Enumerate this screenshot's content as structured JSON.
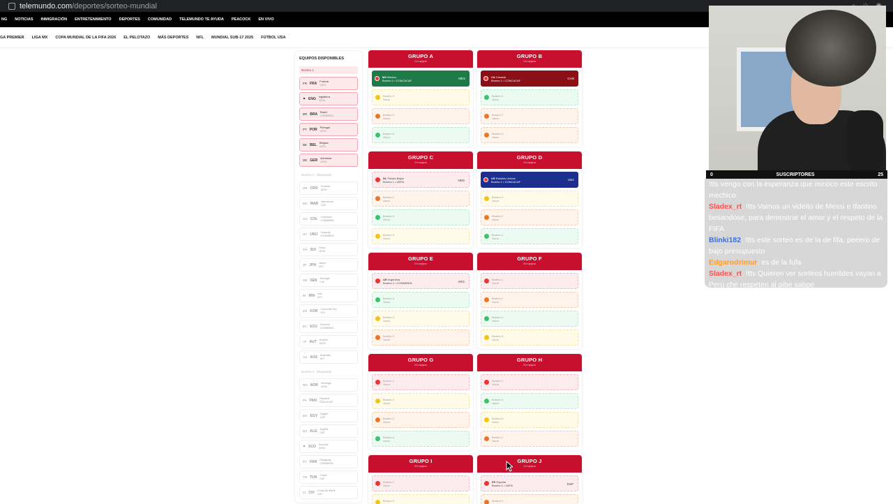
{
  "browser": {
    "host": "telemundo.com",
    "path": "/deportes/sorteo-mundial"
  },
  "nav_primary": [
    "NG",
    "NOTICIAS",
    "INMIGRACIÓN",
    "ENTRETENIMIENTO",
    "DEPORTES",
    "COMUNIDAD",
    "TELEMUNDO TE AYUDA",
    "PEACOCK",
    "EN VIVO"
  ],
  "nav_secondary": [
    "GA PREMIER",
    "LIGA MX",
    "COPA MUNDIAL DE LA FIFA 2026",
    "EL PELOTAZO",
    "MÁS DEPORTES",
    "NFL",
    "MUNDIAL SUB-17 2025",
    "FÚTBOL USA"
  ],
  "available": {
    "title": "EQUIPOS DISPONIBLES",
    "bombo1_title": "Bombo 1",
    "bombo1": [
      {
        "flag": "FR",
        "code": "FRA",
        "name": "Francia",
        "conf": "UEFA"
      },
      {
        "flag": "⚑",
        "code": "ENG",
        "name": "Inglaterra",
        "conf": "UEFA"
      },
      {
        "flag": "BR",
        "code": "BRA",
        "name": "Brasil",
        "conf": "CONMEBOL"
      },
      {
        "flag": "PT",
        "code": "POR",
        "name": "Portugal",
        "conf": "UEFA"
      },
      {
        "flag": "BE",
        "code": "BEL",
        "name": "Bélgica",
        "conf": "UEFA"
      },
      {
        "flag": "DE",
        "code": "GER",
        "name": "Alemania",
        "conf": "UEFA"
      }
    ],
    "bombo2_title": "Bombo 2 · Bloqueado",
    "bombo2": [
      {
        "flag": "HR",
        "code": "CRO",
        "name": "Croacia",
        "conf": "UEFA"
      },
      {
        "flag": "MA",
        "code": "MAR",
        "name": "Marruecos",
        "conf": "CAF"
      },
      {
        "flag": "CO",
        "code": "COL",
        "name": "Colombia",
        "conf": "CONMEBOL"
      },
      {
        "flag": "UY",
        "code": "URU",
        "name": "Uruguay",
        "conf": "CONMEBOL"
      },
      {
        "flag": "CH",
        "code": "SUI",
        "name": "Suiza",
        "conf": "UEFA"
      },
      {
        "flag": "JP",
        "code": "JPN",
        "name": "Japón",
        "conf": "AFC"
      },
      {
        "flag": "SN",
        "code": "SEN",
        "name": "Senegal",
        "conf": "CAF"
      },
      {
        "flag": "IR",
        "code": "IRN",
        "name": "Irán",
        "conf": "AFC"
      },
      {
        "flag": "KR",
        "code": "KOR",
        "name": "Corea del Sur",
        "conf": "AFC"
      },
      {
        "flag": "EC",
        "code": "ECU",
        "name": "Ecuador",
        "conf": "CONMEBOL"
      },
      {
        "flag": "AT",
        "code": "AUT",
        "name": "Austria",
        "conf": "UEFA"
      },
      {
        "flag": "AU",
        "code": "AUS",
        "name": "Australia",
        "conf": "AFC"
      }
    ],
    "bombo3_title": "Bombo 3 · Bloqueado",
    "bombo3": [
      {
        "flag": "NO",
        "code": "NOR",
        "name": "Noruega",
        "conf": "UEFA"
      },
      {
        "flag": "PA",
        "code": "PAN",
        "name": "Panamá",
        "conf": "CONCACAF"
      },
      {
        "flag": "EG",
        "code": "EGY",
        "name": "Egipto",
        "conf": "CAF"
      },
      {
        "flag": "DZ",
        "code": "ALG",
        "name": "Argelia",
        "conf": "CAF"
      },
      {
        "flag": "⚑",
        "code": "SCO",
        "name": "Escocia",
        "conf": "UEFA"
      },
      {
        "flag": "PY",
        "code": "PAR",
        "name": "Paraguay",
        "conf": "CONMEBOL"
      },
      {
        "flag": "TN",
        "code": "TUN",
        "name": "Túnez",
        "conf": "CAF"
      },
      {
        "flag": "CI",
        "code": "CIV",
        "name": "Costa de Marfil",
        "conf": "CAF"
      }
    ]
  },
  "groups": [
    {
      "name": "GRUPO A",
      "count": "1/4 equipos",
      "slots": [
        {
          "color": "filled-green",
          "flag": "MX",
          "label": "México",
          "sub": "Bombo 1 • CONCACAF",
          "code": "MEX"
        },
        {
          "color": "yellow",
          "label": "Bombo 3",
          "sub": "Vacío"
        },
        {
          "color": "orange",
          "label": "Bombo 2",
          "sub": "Vacío"
        },
        {
          "color": "green",
          "label": "Bombo 4",
          "sub": "Vacío"
        }
      ]
    },
    {
      "name": "GRUPO B",
      "count": "1/4 equipos",
      "slots": [
        {
          "color": "filled-red",
          "flag": "CA",
          "label": "Canadá",
          "sub": "Bombo 1 • CONCACAF",
          "code": "CAN"
        },
        {
          "color": "green",
          "label": "Bombo 4",
          "sub": "Vacío"
        },
        {
          "color": "orange",
          "label": "Bombo 2",
          "sub": "Vacío"
        },
        {
          "color": "orange",
          "label": "Bombo 3",
          "sub": "Vacío"
        }
      ]
    },
    {
      "name": "GRUPO C",
      "count": "1/4 equipos",
      "slots": [
        {
          "color": "light-red",
          "flag": "NL",
          "label": "Países Bajos",
          "sub": "Bombo 1 • UEFA",
          "code": "NED"
        },
        {
          "color": "orange",
          "label": "Bombo 2",
          "sub": "Vacío"
        },
        {
          "color": "green",
          "label": "Bombo 4",
          "sub": "Vacío"
        },
        {
          "color": "yellow",
          "label": "Bombo 3",
          "sub": "Vacío"
        }
      ]
    },
    {
      "name": "GRUPO D",
      "count": "1/4 equipos",
      "slots": [
        {
          "color": "filled-blue",
          "flag": "US",
          "label": "Estados Unidos",
          "sub": "Bombo 1 • CONCACAF",
          "code": "USA"
        },
        {
          "color": "yellow",
          "label": "Bombo 3",
          "sub": "Vacío"
        },
        {
          "color": "orange",
          "label": "Bombo 2",
          "sub": "Vacío"
        },
        {
          "color": "green",
          "label": "Bombo 4",
          "sub": "Vacío"
        }
      ]
    },
    {
      "name": "GRUPO E",
      "count": "1/4 equipos",
      "slots": [
        {
          "color": "light-red",
          "flag": "AR",
          "label": "Argentina",
          "sub": "Bombo 1 • CONMEBOL",
          "code": "ARG"
        },
        {
          "color": "green",
          "label": "Bombo 4",
          "sub": "Vacío"
        },
        {
          "color": "yellow",
          "label": "Bombo 3",
          "sub": "Vacío"
        },
        {
          "color": "orange",
          "label": "Bombo 2",
          "sub": "Vacío"
        }
      ]
    },
    {
      "name": "GRUPO F",
      "count": "0/4 equipos",
      "slots": [
        {
          "color": "red",
          "label": "Bombo 1",
          "sub": "Vacío"
        },
        {
          "color": "orange",
          "label": "Bombo 2",
          "sub": "Vacío"
        },
        {
          "color": "green",
          "label": "Bombo 4",
          "sub": "Vacío"
        },
        {
          "color": "yellow",
          "label": "Bombo 3",
          "sub": "Vacío"
        }
      ]
    },
    {
      "name": "GRUPO G",
      "count": "0/4 equipos",
      "slots": [
        {
          "color": "red",
          "label": "Bombo 1",
          "sub": "Vacío"
        },
        {
          "color": "yellow",
          "label": "Bombo 3",
          "sub": "Vacío"
        },
        {
          "color": "orange",
          "label": "Bombo 2",
          "sub": "Vacío"
        },
        {
          "color": "green",
          "label": "Bombo 4",
          "sub": "Vacío"
        }
      ]
    },
    {
      "name": "GRUPO H",
      "count": "0/4 equipos",
      "slots": [
        {
          "color": "red",
          "label": "Bombo 1",
          "sub": "Vacío"
        },
        {
          "color": "green",
          "label": "Bombo 4",
          "sub": "Vacío"
        },
        {
          "color": "yellow",
          "label": "Bombo 3",
          "sub": "Vacío"
        },
        {
          "color": "orange",
          "label": "Bombo 2",
          "sub": "Vacío"
        }
      ]
    },
    {
      "name": "GRUPO I",
      "count": "0/4 equipos",
      "slots": [
        {
          "color": "red",
          "label": "Bombo 1",
          "sub": "Vacío"
        },
        {
          "color": "yellow",
          "label": "Bombo 3",
          "sub": "Vacío"
        }
      ]
    },
    {
      "name": "GRUPO J",
      "count": "1/4 equipos",
      "slots": [
        {
          "color": "light-red",
          "flag": "ES",
          "label": "España",
          "sub": "Bombo 1 • UEFA",
          "code": "ESP"
        },
        {
          "color": "orange",
          "label": "Bombo 2",
          "sub": "Vacío"
        }
      ]
    }
  ],
  "stream": {
    "subs_left": "0",
    "subs_label": "SUSCRIPTORES",
    "subs_right": "25"
  },
  "chat": [
    {
      "user": "",
      "text": "!tts vengo con la esperanza que mexico este escrito mechico",
      "color": "pink"
    },
    {
      "user": "Sladex_rt",
      "text": "!tts Vamos un videito de Messi e Ifantino besandose, para demostrar el amor y el respeto de la FIFA",
      "color": "pink"
    },
    {
      "user": "Blinki182",
      "text": "!tts este sorteo es de la de fifa, peeero de bajo presupuesto",
      "color": "blue"
    },
    {
      "user": "Edgarodrimur",
      "text": "es de la fufa",
      "color": "orange"
    },
    {
      "user": "Sladex_rt",
      "text": "!tts Quieren ver sorteos humildes vayan a Perú che respeten al pibe sabpe",
      "color": "pink"
    }
  ],
  "colors": {
    "accent": "#c8102e",
    "mex": "#1f7a4a",
    "can": "#8b0f17",
    "usa": "#1c2f8f"
  }
}
